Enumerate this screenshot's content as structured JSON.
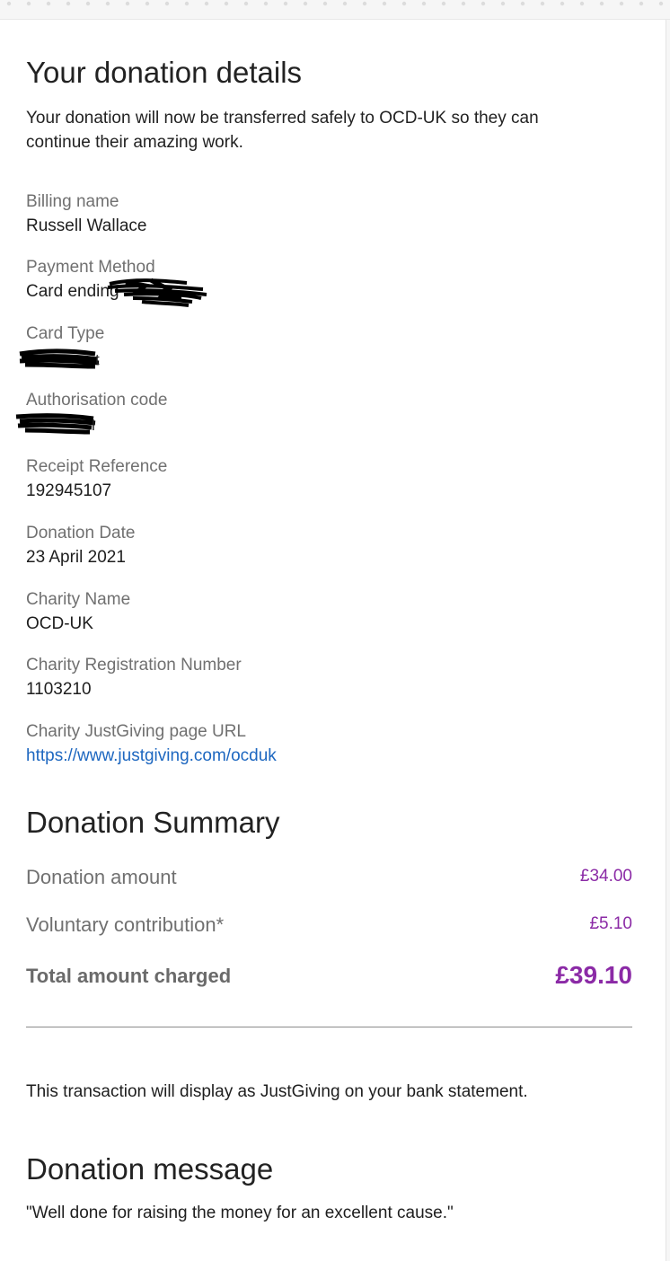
{
  "details": {
    "title": "Your donation details",
    "intro": "Your donation will now be transferred safely to OCD-UK so they can continue their amazing work.",
    "fields": [
      {
        "label": "Billing name",
        "value": "Russell Wallace"
      },
      {
        "label": "Payment Method",
        "value": "Card ending"
      },
      {
        "label": "Card Type",
        "value": ""
      },
      {
        "label": "Authorisation code",
        "value": ""
      },
      {
        "label": "Receipt Reference",
        "value": "192945107"
      },
      {
        "label": "Donation Date",
        "value": "23 April 2021"
      },
      {
        "label": "Charity Name",
        "value": "OCD-UK"
      },
      {
        "label": "Charity Registration Number",
        "value": "1103210"
      },
      {
        "label": "Charity JustGiving page URL",
        "value": "https://www.justgiving.com/ocduk"
      }
    ]
  },
  "summary": {
    "title": "Donation Summary",
    "donation_label": "Donation amount",
    "donation_value": "£34.00",
    "contribution_label": "Voluntary contribution*",
    "contribution_value": "£5.10",
    "total_label": "Total amount charged",
    "total_value": "£39.10",
    "accent_color": "#8b2aa6"
  },
  "bank_note": "This transaction will display as JustGiving on your bank statement.",
  "message": {
    "title": "Donation message",
    "text": "\"Well done for raising the money for an excellent cause.\""
  },
  "colors": {
    "link": "#1d67c0",
    "label": "#707070",
    "redaction": "#000000"
  }
}
